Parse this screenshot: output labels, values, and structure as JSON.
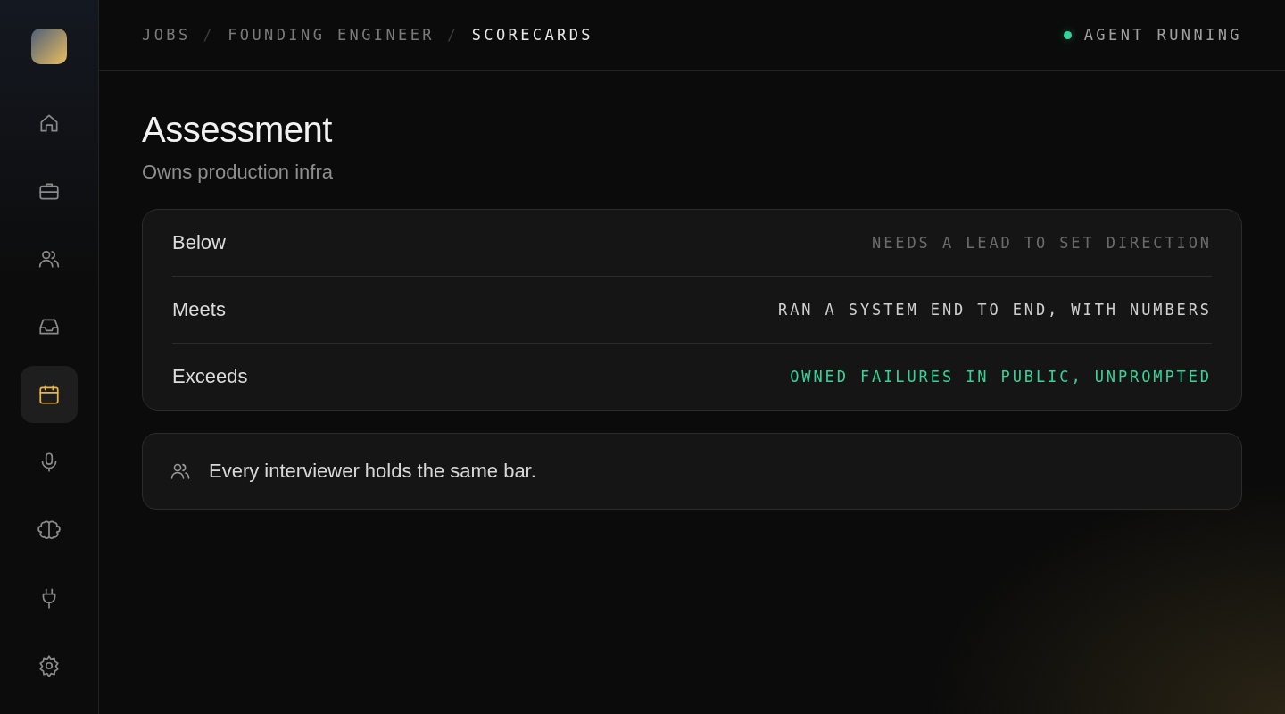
{
  "sidebar": {
    "items": [
      {
        "kind": "home",
        "selected": false
      },
      {
        "kind": "briefcase",
        "selected": false
      },
      {
        "kind": "users",
        "selected": false
      },
      {
        "kind": "inbox",
        "selected": false
      },
      {
        "kind": "calendar",
        "selected": true
      },
      {
        "kind": "mic",
        "selected": false
      },
      {
        "kind": "brain",
        "selected": false
      },
      {
        "kind": "plug",
        "selected": false
      },
      {
        "kind": "gear",
        "selected": false
      }
    ]
  },
  "breadcrumb": [
    {
      "kind": "link",
      "label": "JOBS",
      "current": false
    },
    {
      "kind": "separator",
      "label": "/"
    },
    {
      "kind": "link",
      "label": "FOUNDING ENGINEER",
      "current": false
    },
    {
      "kind": "separator",
      "label": "/"
    },
    {
      "kind": "link",
      "label": "SCORECARDS",
      "current": true
    }
  ],
  "status": {
    "label": "AGENT RUNNING",
    "color": "#34d399"
  },
  "title": "Assessment",
  "subtitle": "Owns production infra",
  "levels": [
    {
      "name": "Below",
      "description": "NEEDS A LEAD TO SET DIRECTION",
      "color": "#6b6b6b"
    },
    {
      "name": "Meets",
      "description": "RAN A SYSTEM END TO END, WITH NUMBERS",
      "color": "#cfcfcf"
    },
    {
      "name": "Exceeds",
      "description": "OWNED FAILURES IN PUBLIC, UNPROMPTED",
      "color": "#34d399"
    }
  ],
  "note": "Every interviewer holds the same bar."
}
